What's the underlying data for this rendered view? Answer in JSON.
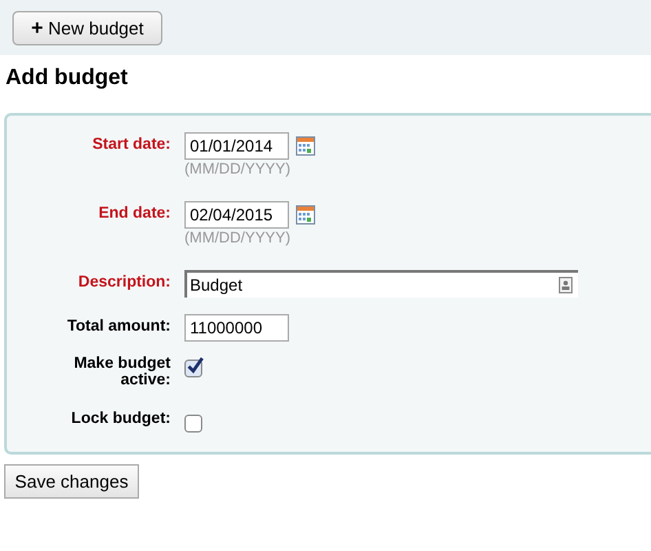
{
  "toolbar": {
    "button": {
      "icon": "+",
      "label": "New budget"
    }
  },
  "heading": "Add budget",
  "fields": [
    {
      "kind": "date",
      "label": "Start date:",
      "required": true,
      "value": "01/01/2014",
      "hint": "(MM/DD/YYYY)"
    },
    {
      "kind": "date",
      "label": "End date:",
      "required": true,
      "value": "02/04/2015",
      "hint": "(MM/DD/YYYY)"
    },
    {
      "kind": "wide",
      "label": "Description:",
      "required": true,
      "value": "Budget"
    },
    {
      "kind": "text",
      "label": "Total amount:",
      "required": false,
      "value": "11000000"
    },
    {
      "kind": "checkbox",
      "label": "Make budget active:",
      "required": false,
      "checked": true
    },
    {
      "kind": "checkbox",
      "label": "Lock budget:",
      "required": false,
      "checked": false
    }
  ],
  "submit": "Save changes"
}
